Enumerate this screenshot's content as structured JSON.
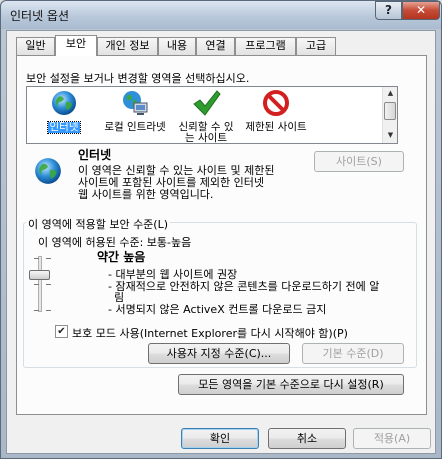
{
  "window": {
    "title": "인터넷 옵션",
    "help_glyph": "?",
    "close_glyph": "✕"
  },
  "tabs": [
    {
      "label": "일반"
    },
    {
      "label": "보안"
    },
    {
      "label": "개인 정보"
    },
    {
      "label": "내용"
    },
    {
      "label": "연결"
    },
    {
      "label": "프로그램"
    },
    {
      "label": "고급"
    }
  ],
  "security": {
    "instruction": "보안 설정을 보거나 변경할 영역을 선택하십시오.",
    "zones": [
      {
        "label": "인터넷",
        "icon": "globe-icon"
      },
      {
        "label": "로컬 인트라넷",
        "icon": "intranet-icon"
      },
      {
        "label": "신뢰할 수 있는 사이트",
        "icon": "checkmark-icon"
      },
      {
        "label": "제한된 사이트",
        "icon": "restricted-icon"
      }
    ],
    "zone_title": "인터넷",
    "zone_desc_line1": "이 영역은 신뢰할 수 있는 사이트 및 제한된",
    "zone_desc_line2": "사이트에 포함된 사이트를 제외한 인터넷",
    "zone_desc_line3": "웹 사이트를 위한 영역입니다.",
    "sites_button": "사이트(S)",
    "level_group_label": "이 영역에 적용할 보안 수준(L)",
    "allowed_levels": "이 영역에 허용된 수준: 보통-높음",
    "level_name": "약간 높음",
    "level_desc_1": "- 대부분의 웹 사이트에 권장",
    "level_desc_2a": "- 잠재적으로 안전하지 않은 콘텐츠를 다운로드하기 전에 알",
    "level_desc_2b": "림",
    "level_desc_3": "- 서명되지 않은 ActiveX 컨트롤 다운로드 금지",
    "protected_mode_label": "보호 모드 사용(Internet Explorer를 다시 시작해야 함)(P)",
    "protected_mode_checked": true,
    "custom_level_button": "사용자 지정 수준(C)...",
    "default_level_button": "기본 수준(D)",
    "reset_all_button": "모든 영역을 기본 수준으로 다시 설정(R)"
  },
  "footer": {
    "ok": "확인",
    "cancel": "취소",
    "apply": "적용(A)"
  },
  "colors": {
    "selection": "#3399ff",
    "check": "#2e9d2e",
    "restricted": "#d21f1f"
  }
}
